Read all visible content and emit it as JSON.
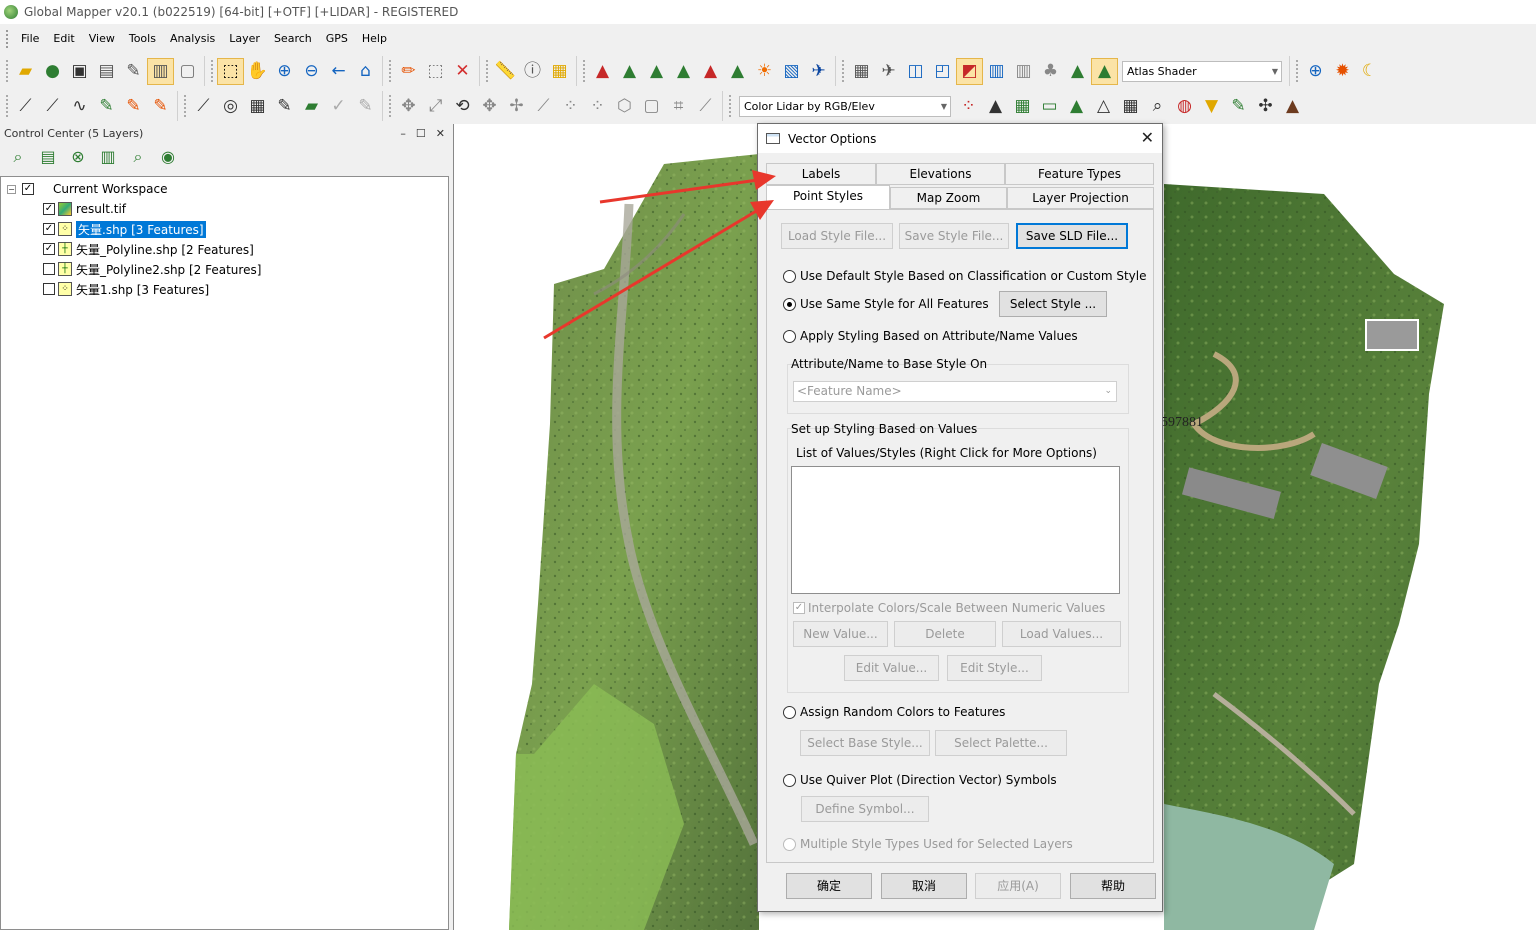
{
  "window": {
    "title": "Global Mapper v20.1 (b022519) [64-bit] [+OTF] [+LIDAR] - REGISTERED"
  },
  "menu": [
    "File",
    "Edit",
    "View",
    "Tools",
    "Analysis",
    "Layer",
    "Search",
    "GPS",
    "Help"
  ],
  "toolbar": {
    "shader_combo": "Atlas Shader",
    "lidar_combo": "Color Lidar by RGB/Elev"
  },
  "control_center": {
    "title": "Control Center (5 Layers)",
    "workspace": "Current Workspace",
    "layers": [
      {
        "name": "result.tif",
        "checked": true
      },
      {
        "name": "矢量.shp [3 Features]",
        "checked": true,
        "selected": true
      },
      {
        "name": "矢量_Polyline.shp [2 Features]",
        "checked": true
      },
      {
        "name": "矢量_Polyline2.shp [2 Features]",
        "checked": false
      },
      {
        "name": "矢量1.shp [3 Features]",
        "checked": false
      }
    ]
  },
  "map": {
    "label": "597881"
  },
  "dialog": {
    "title": "Vector Options",
    "tabs": {
      "labels": "Labels",
      "elevations": "Elevations",
      "feature_types": "Feature Types",
      "point_styles": "Point Styles",
      "map_zoom": "Map Zoom",
      "layer_projection": "Layer Projection"
    },
    "load_style": "Load Style File...",
    "save_style": "Save Style File...",
    "save_sld": "Save SLD File...",
    "opt_default": "Use Default Style Based on Classification or Custom Style",
    "opt_same": "Use Same Style for All Features",
    "select_style": "Select Style ...",
    "opt_attribute": "Apply Styling Based on Attribute/Name Values",
    "attr_label": "Attribute/Name to Base Style On",
    "attr_value": "<Feature Name>",
    "setup_label": "Set up Styling Based on Values",
    "list_label": "List of Values/Styles (Right Click for More Options)",
    "interpolate": "Interpolate Colors/Scale Between Numeric Values",
    "new_value": "New Value...",
    "delete": "Delete",
    "load_values": "Load Values...",
    "edit_value": "Edit Value...",
    "edit_style": "Edit Style...",
    "opt_random": "Assign Random Colors to Features",
    "select_base": "Select Base Style...",
    "select_palette": "Select Palette...",
    "opt_quiver": "Use Quiver Plot (Direction Vector) Symbols",
    "define_symbol": "Define Symbol...",
    "opt_multiple": "Multiple Style Types Used for Selected Layers",
    "ok": "确定",
    "cancel": "取消",
    "apply": "应用(A)",
    "help": "帮助"
  },
  "colors": {
    "selection": "#0078d7",
    "arrow": "#e8372c"
  }
}
